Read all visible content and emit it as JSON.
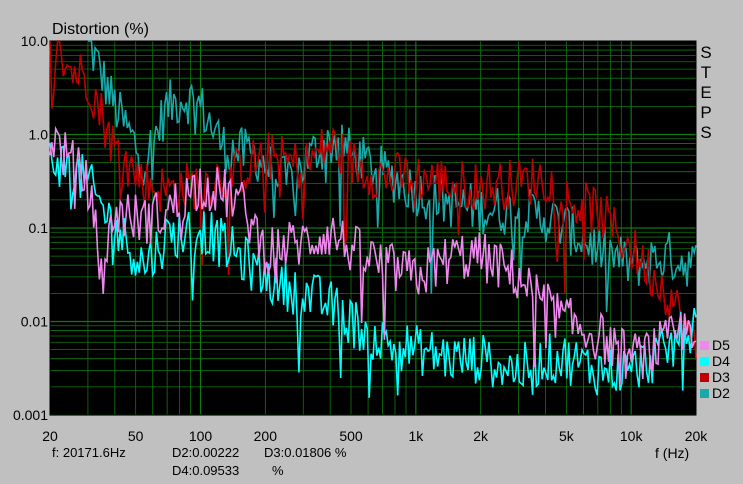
{
  "chart_data": {
    "type": "line",
    "title": "Distortion (%)",
    "xlabel": "f (Hz)",
    "ylabel": "Distortion (%)",
    "x_scale": "log",
    "y_scale": "log",
    "xlim": [
      20,
      20000
    ],
    "ylim": [
      0.001,
      10
    ],
    "grid": true,
    "legend_position": "bottom-right",
    "x_ticks": [
      "20",
      "50",
      "100",
      "200",
      "500",
      "1k",
      "2k",
      "5k",
      "10k",
      "20k"
    ],
    "y_ticks": [
      "10.0",
      "1.0",
      "0.1",
      "0.01",
      "0.001"
    ],
    "side_label": [
      "S",
      "T",
      "E",
      "P",
      "S"
    ],
    "colors": {
      "background": "#000000",
      "grid": "#0d7a0d",
      "D2": "#1aa8a8",
      "D3": "#c00000",
      "D4": "#00ffff",
      "D5": "#ee88ee"
    },
    "series": [
      {
        "name": "D2",
        "x": [
          30,
          40,
          55,
          70,
          85,
          100,
          130,
          180,
          250,
          350,
          450,
          500,
          700,
          1000,
          1500,
          2000,
          3000,
          4000,
          5000,
          7000,
          10000,
          15000,
          20000
        ],
        "values": [
          10.0,
          2.0,
          0.5,
          2.0,
          2.5,
          2.0,
          0.7,
          0.6,
          0.3,
          0.7,
          0.9,
          0.6,
          0.4,
          0.25,
          0.18,
          0.16,
          0.15,
          0.13,
          0.1,
          0.06,
          0.04,
          0.05,
          0.04
        ]
      },
      {
        "name": "D3",
        "x": [
          20,
          25,
          30,
          40,
          55,
          70,
          100,
          150,
          200,
          300,
          400,
          500,
          700,
          1000,
          1500,
          2000,
          3000,
          4000,
          5000,
          7000,
          10000,
          15000,
          20000
        ],
        "values": [
          10.0,
          5.0,
          4.0,
          0.7,
          0.3,
          0.25,
          0.3,
          0.4,
          0.6,
          0.45,
          0.8,
          0.5,
          0.35,
          0.35,
          0.3,
          0.28,
          0.3,
          0.35,
          0.2,
          0.15,
          0.06,
          0.02,
          0.005
        ]
      },
      {
        "name": "D4",
        "x": [
          20,
          30,
          40,
          55,
          70,
          100,
          150,
          200,
          300,
          400,
          500,
          700,
          1000,
          1500,
          2000,
          3000,
          4000,
          5000,
          7000,
          10000,
          15000,
          20000
        ],
        "values": [
          0.6,
          0.3,
          0.1,
          0.04,
          0.08,
          0.1,
          0.05,
          0.03,
          0.02,
          0.015,
          0.01,
          0.006,
          0.005,
          0.004,
          0.004,
          0.003,
          0.004,
          0.004,
          0.003,
          0.003,
          0.005,
          0.01
        ]
      },
      {
        "name": "D5",
        "x": [
          20,
          25,
          30,
          35,
          40,
          55,
          70,
          100,
          150,
          200,
          300,
          400,
          500,
          700,
          1000,
          1500,
          2000,
          3000,
          4000,
          5000,
          7000,
          10000,
          15000,
          20000
        ],
        "values": [
          1.0,
          0.5,
          0.3,
          0.03,
          0.15,
          0.12,
          0.15,
          0.3,
          0.2,
          0.06,
          0.07,
          0.09,
          0.06,
          0.04,
          0.03,
          0.05,
          0.05,
          0.03,
          0.015,
          0.01,
          0.007,
          0.004,
          0.006,
          0.01
        ]
      }
    ]
  },
  "readout": {
    "freq": "f: 20171.6Hz",
    "d2": "D2:0.00222",
    "d3": "D3:0.01806 %",
    "d4": "D4:0.09533",
    "d4_unit": "%"
  }
}
